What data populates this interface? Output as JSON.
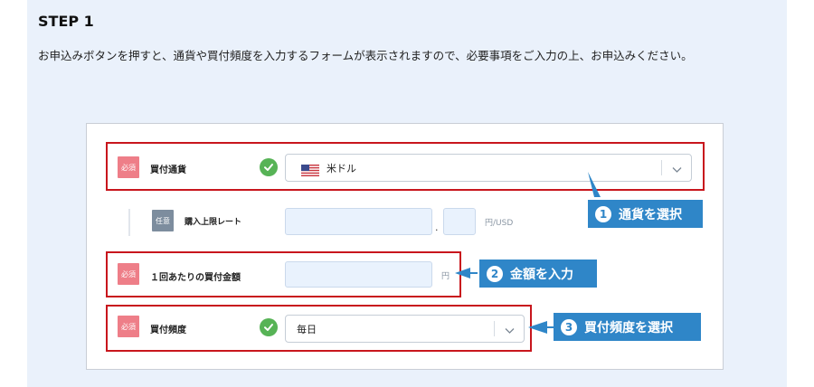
{
  "step": {
    "title": "STEP 1"
  },
  "description": "お申込みボタンを押すと、通貨や買付頻度を入力するフォームが表示されますので、必要事項をご入力の上、お申込みください。",
  "form": {
    "required_badge": "必須",
    "optional_badge": "任意",
    "currency": {
      "label": "買付通貨",
      "value": "米ドル",
      "flag": "us-flag-icon"
    },
    "limit_rate": {
      "label": "購入上限レート",
      "decimal_point": ".",
      "unit": "円/USD"
    },
    "amount": {
      "label": "１回あたりの買付金額",
      "unit": "円"
    },
    "frequency": {
      "label": "買付頻度",
      "value": "毎日"
    }
  },
  "callouts": [
    {
      "num": "1",
      "text": "通貨を選択"
    },
    {
      "num": "2",
      "text": "金額を入力"
    },
    {
      "num": "3",
      "text": "買付頻度を選択"
    }
  ],
  "colors": {
    "panel_bg": "#eaf1fb",
    "highlight_border": "#c8161d",
    "callout_bg": "#2f86c8",
    "required_badge": "#ee7e88",
    "optional_badge": "#7d8d9e",
    "check": "#57b356"
  }
}
